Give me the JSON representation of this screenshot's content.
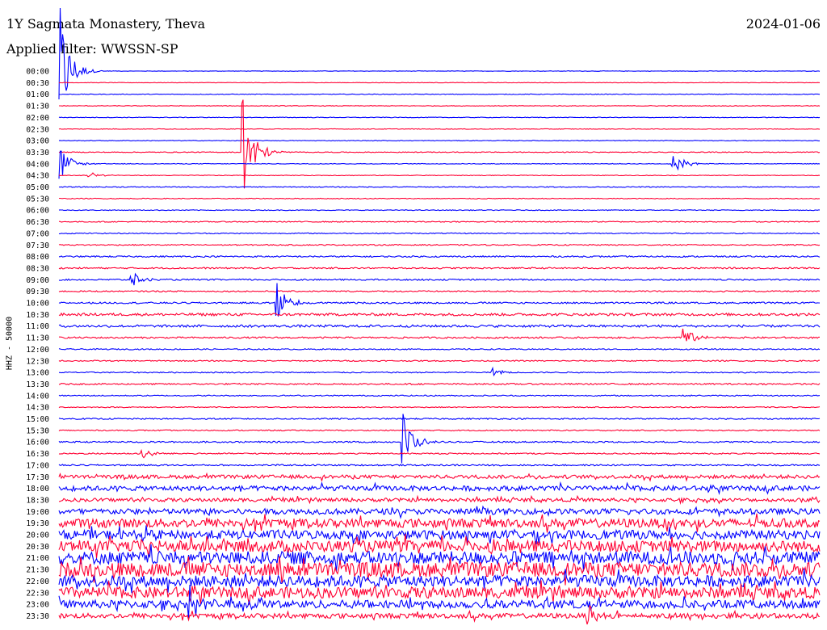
{
  "header": {
    "station": "1Y Sagmata Monastery, Theva",
    "date": "2024-01-06",
    "filter": "Applied filter: WWSSN-SP"
  },
  "channel_label": "HHZ - 50000",
  "colors": {
    "odd_trace": "#0000ff",
    "even_trace": "#ff0033",
    "background": "#ffffff"
  },
  "chart_data": {
    "type": "line",
    "title": "1Y Sagmata Monastery, Theva",
    "ylabel": "HHZ - 50000",
    "time_labels": [
      "00:00",
      "00:30",
      "01:00",
      "01:30",
      "02:00",
      "02:30",
      "03:00",
      "03:30",
      "04:00",
      "04:30",
      "05:00",
      "05:30",
      "06:00",
      "06:30",
      "07:00",
      "07:30",
      "08:00",
      "08:30",
      "09:00",
      "09:30",
      "10:00",
      "10:30",
      "11:00",
      "11:30",
      "12:00",
      "12:30",
      "13:00",
      "13:30",
      "14:00",
      "14:30",
      "15:00",
      "15:30",
      "16:00",
      "16:30",
      "17:00",
      "17:30",
      "18:00",
      "18:30",
      "19:00",
      "19:30",
      "20:00",
      "20:30",
      "21:00",
      "21:30",
      "22:00",
      "22:30",
      "23:00",
      "23:30"
    ],
    "x_range_minutes": [
      0,
      30
    ],
    "trace_colors": [
      "#0000ff",
      "#ff0033"
    ],
    "noise_level_per_row": [
      0.3,
      0.3,
      0.4,
      0.4,
      0.4,
      0.4,
      0.4,
      0.5,
      0.4,
      0.4,
      0.5,
      0.5,
      0.5,
      0.6,
      0.6,
      0.7,
      0.9,
      0.9,
      0.9,
      0.8,
      1.0,
      1.6,
      1.5,
      1.0,
      0.7,
      0.7,
      0.7,
      0.9,
      0.7,
      0.6,
      0.8,
      0.7,
      0.9,
      0.8,
      0.9,
      2.2,
      3.0,
      2.2,
      3.5,
      5.5,
      5.5,
      7,
      8,
      9,
      7,
      7,
      5,
      3
    ],
    "events": [
      {
        "row": 0,
        "minute": 0.0,
        "amplitude": 90
      },
      {
        "row": 7,
        "minute": 7.2,
        "amplitude": 95
      },
      {
        "row": 8,
        "minute": 0.0,
        "amplitude": 28
      },
      {
        "row": 8,
        "minute": 24.1,
        "amplitude": 22
      },
      {
        "row": 9,
        "minute": 1.1,
        "amplitude": 6
      },
      {
        "row": 18,
        "minute": 2.8,
        "amplitude": 12
      },
      {
        "row": 20,
        "minute": 8.5,
        "amplitude": 40
      },
      {
        "row": 23,
        "minute": 24.5,
        "amplitude": 20
      },
      {
        "row": 26,
        "minute": 17.0,
        "amplitude": 8
      },
      {
        "row": 32,
        "minute": 13.5,
        "amplitude": 45
      },
      {
        "row": 33,
        "minute": 3.2,
        "amplitude": 9
      },
      {
        "row": 46,
        "minute": 5.1,
        "amplitude": 30
      },
      {
        "row": 47,
        "minute": 20.8,
        "amplitude": 20
      }
    ]
  }
}
